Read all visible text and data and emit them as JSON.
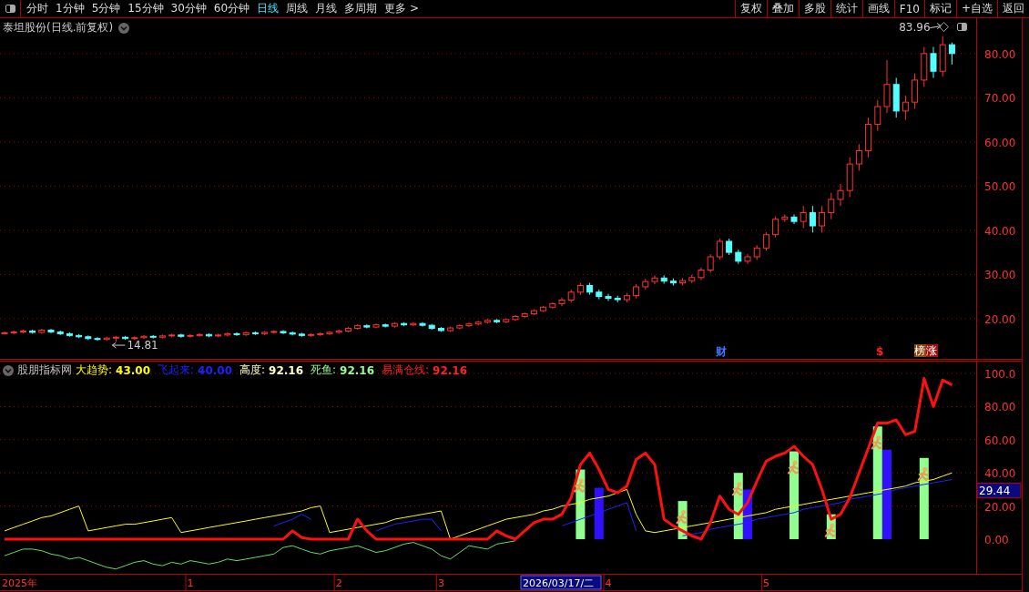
{
  "toolbar": {
    "periods": [
      {
        "label": "分时",
        "selected": false
      },
      {
        "label": "1分钟",
        "selected": false
      },
      {
        "label": "5分钟",
        "selected": false
      },
      {
        "label": "15分钟",
        "selected": false
      },
      {
        "label": "30分钟",
        "selected": false
      },
      {
        "label": "60分钟",
        "selected": false
      },
      {
        "label": "日线",
        "selected": true
      },
      {
        "label": "周线",
        "selected": false
      },
      {
        "label": "月线",
        "selected": false
      },
      {
        "label": "多周期",
        "selected": false
      },
      {
        "label": "更多 >",
        "selected": false
      }
    ],
    "buttons": [
      "复权",
      "叠加",
      "多股",
      "统计",
      "画线",
      "F10",
      "标记",
      "+自选",
      "返回"
    ]
  },
  "price_panel": {
    "title": "泰坦股份(日线.前复权)",
    "chart_data": {
      "type": "candlestick",
      "grid": true,
      "ylim": [
        10.7,
        88
      ],
      "yticks": [
        {
          "value": 20,
          "label": "20.00"
        },
        {
          "value": 30,
          "label": "30.00"
        },
        {
          "value": 40,
          "label": "40.00"
        },
        {
          "value": 50,
          "label": "50.00"
        },
        {
          "value": 60,
          "label": "60.00"
        },
        {
          "value": 70,
          "label": "70.00"
        },
        {
          "value": 80,
          "label": "80.00"
        }
      ],
      "ohlc": [
        [
          16.7,
          17.1,
          16.4,
          16.8
        ],
        [
          16.8,
          17.3,
          16.5,
          17
        ],
        [
          17,
          17.5,
          16.7,
          17.2
        ],
        [
          17.2,
          17.5,
          16.6,
          16.9
        ],
        [
          16.9,
          17.7,
          16.6,
          17.4
        ],
        [
          17.4,
          17.7,
          16.7,
          17
        ],
        [
          17,
          17.3,
          16.3,
          16.6
        ],
        [
          16.6,
          16.9,
          15.9,
          16.2
        ],
        [
          16.2,
          16.5,
          15.6,
          15.9
        ],
        [
          15.9,
          16.2,
          15.2,
          15.5
        ],
        [
          15.5,
          15.8,
          15,
          15.3
        ],
        [
          15.3,
          15.9,
          15,
          15.6
        ],
        [
          15.6,
          16.1,
          14.81,
          15.8
        ],
        [
          15.8,
          16.1,
          15.2,
          15.5
        ],
        [
          15.5,
          16,
          15.2,
          15.7
        ],
        [
          15.7,
          16.3,
          15.4,
          16
        ],
        [
          16,
          16.3,
          15.5,
          15.8
        ],
        [
          15.8,
          16.4,
          15.5,
          16.1
        ],
        [
          16.1,
          16.6,
          15.8,
          16.3
        ],
        [
          16.3,
          16.6,
          15.7,
          16
        ],
        [
          16,
          16.5,
          15.7,
          16.2
        ],
        [
          16.2,
          16.7,
          15.9,
          16.4
        ],
        [
          16.4,
          16.7,
          15.8,
          16.1
        ],
        [
          16.1,
          16.6,
          15.8,
          16.3
        ],
        [
          16.3,
          16.9,
          16,
          16.6
        ],
        [
          16.6,
          16.9,
          16.1,
          16.4
        ],
        [
          16.4,
          17.1,
          16.1,
          16.8
        ],
        [
          16.8,
          17.1,
          16.3,
          16.6
        ],
        [
          16.6,
          17.2,
          16.3,
          16.9
        ],
        [
          16.9,
          17.4,
          16.6,
          17.1
        ],
        [
          17.1,
          17.4,
          16.5,
          16.8
        ],
        [
          16.8,
          17.1,
          16.2,
          16.5
        ],
        [
          16.5,
          16.8,
          15.9,
          16.2
        ],
        [
          16.2,
          16.7,
          15.9,
          16.4
        ],
        [
          16.4,
          16.9,
          16.1,
          16.6
        ],
        [
          16.6,
          17.2,
          16.3,
          16.9
        ],
        [
          16.9,
          17.5,
          16.6,
          17.2
        ],
        [
          17.2,
          18.1,
          16.9,
          17.8
        ],
        [
          17.8,
          18.7,
          17.5,
          18.4
        ],
        [
          18.4,
          18.7,
          17.8,
          18.1
        ],
        [
          18.1,
          18.9,
          17.8,
          18.6
        ],
        [
          18.6,
          18.9,
          18,
          18.3
        ],
        [
          18.3,
          19.2,
          18,
          18.9
        ],
        [
          18.9,
          19.2,
          18.3,
          18.6
        ],
        [
          18.6,
          19.2,
          18.3,
          18.9
        ],
        [
          18.9,
          19.2,
          18.2,
          18.5
        ],
        [
          18.5,
          18.8,
          17.5,
          17.8
        ],
        [
          17.8,
          18.1,
          17,
          17.3
        ],
        [
          17.3,
          18.2,
          17,
          17.9
        ],
        [
          17.9,
          18.7,
          17.6,
          18.4
        ],
        [
          18.4,
          19.1,
          18.1,
          18.8
        ],
        [
          18.8,
          19.5,
          18.5,
          19.2
        ],
        [
          19.2,
          19.9,
          18.9,
          19.6
        ],
        [
          19.6,
          19.9,
          19,
          19.3
        ],
        [
          19.3,
          20.1,
          19,
          19.8
        ],
        [
          19.8,
          20.8,
          19.5,
          20.5
        ],
        [
          20.5,
          21.4,
          20.2,
          21.1
        ],
        [
          21.1,
          22.1,
          20.8,
          21.8
        ],
        [
          21.8,
          22.9,
          21.5,
          22.6
        ],
        [
          22.6,
          23.7,
          22.3,
          23.4
        ],
        [
          23.4,
          24.8,
          22.8,
          24.2
        ],
        [
          24.2,
          26.6,
          23.6,
          26
        ],
        [
          26,
          28.1,
          25.4,
          27.5
        ],
        [
          27.5,
          28.1,
          25.4,
          26
        ],
        [
          26,
          26.6,
          24.4,
          25
        ],
        [
          25,
          25.6,
          24,
          24.6
        ],
        [
          24.6,
          25.2,
          23.7,
          24.3
        ],
        [
          24.3,
          25.8,
          23.7,
          25.2
        ],
        [
          25.2,
          27.8,
          24.6,
          27.2
        ],
        [
          27.2,
          29,
          26.6,
          28.4
        ],
        [
          28.4,
          29.8,
          27.8,
          29.2
        ],
        [
          29.2,
          29.8,
          27.9,
          28.5
        ],
        [
          28.5,
          29.1,
          27.5,
          28.1
        ],
        [
          28.1,
          29.2,
          27.5,
          28.6
        ],
        [
          28.6,
          29.9,
          28,
          29.3
        ],
        [
          29.3,
          31.6,
          28.7,
          31
        ],
        [
          31,
          34.6,
          30.4,
          34
        ],
        [
          34,
          38.1,
          33.4,
          37.5
        ],
        [
          37.5,
          38.1,
          34.4,
          35
        ],
        [
          35,
          35.6,
          32.4,
          33
        ],
        [
          33,
          34.6,
          32.4,
          34
        ],
        [
          34,
          36.6,
          33.3,
          36
        ],
        [
          36,
          39.6,
          35.4,
          39
        ],
        [
          39,
          43.1,
          38.4,
          42.5
        ],
        [
          42.5,
          43.6,
          41.9,
          43
        ],
        [
          43,
          43.6,
          41.4,
          42
        ],
        [
          42,
          45.5,
          40.5,
          44
        ],
        [
          44,
          45.5,
          39.5,
          41
        ],
        [
          41,
          45.5,
          39.5,
          44
        ],
        [
          44,
          48.5,
          42.5,
          47
        ],
        [
          47,
          50.5,
          45.5,
          49
        ],
        [
          49,
          56.5,
          47.5,
          55
        ],
        [
          55,
          59.5,
          53.5,
          58
        ],
        [
          58,
          65.5,
          56.5,
          64
        ],
        [
          64,
          69.5,
          62.5,
          68
        ],
        [
          68,
          78.5,
          66.5,
          73
        ],
        [
          73,
          74.5,
          65.5,
          67
        ],
        [
          67,
          70.5,
          65,
          69
        ],
        [
          69,
          75.5,
          67.5,
          74
        ],
        [
          74,
          81.5,
          72.5,
          80
        ],
        [
          80,
          81.5,
          74.5,
          76
        ],
        [
          76,
          83.96,
          74.8,
          82
        ],
        [
          82,
          82.5,
          77.5,
          80
        ]
      ],
      "annotations": [
        "83.96",
        "14.81"
      ]
    },
    "event_marks": [
      {
        "text": "财",
        "color": "#3c78ff",
        "badge": false
      },
      {
        "text": "$",
        "color": "#ff2020",
        "badge": false
      },
      {
        "text": "榜",
        "color": "#8a4a10",
        "badge": true
      },
      {
        "text": "涨",
        "color": "#a01010",
        "badge": true
      }
    ]
  },
  "indicator_panel": {
    "legend": [
      {
        "label": "股朋指标网"
      },
      {
        "label": "大趋势:",
        "value": "43.00",
        "color": "#ffff00"
      },
      {
        "label": "飞起来:",
        "value": "40.00",
        "color": "#2020ff"
      },
      {
        "label": "高度:",
        "value": "92.16",
        "color": "#ffffc0"
      },
      {
        "label": "死鱼:",
        "value": "92.16",
        "color": "#90ff90"
      },
      {
        "label": "易满仓线:",
        "value": "92.16",
        "color": "#ff2020"
      }
    ],
    "axis_start_label": "2025年",
    "chart_data": {
      "type": "line",
      "grid": true,
      "ylim": [
        -20.9,
        107.7
      ],
      "yticks": [
        {
          "value": 0,
          "label": "0.00"
        },
        {
          "value": 20,
          "label": "20.00"
        },
        {
          "value": 40,
          "label": "40.00"
        },
        {
          "value": 60,
          "label": "60.00"
        },
        {
          "value": 80,
          "label": "80.00"
        },
        {
          "value": 100,
          "label": "100.0"
        }
      ],
      "categories": [
        null,
        null,
        null,
        null,
        null,
        null,
        null,
        null,
        null,
        null,
        null,
        null,
        null,
        null,
        null,
        null,
        null,
        null,
        null,
        null,
        "1",
        null,
        null,
        null,
        null,
        null,
        null,
        null,
        null,
        null,
        null,
        null,
        null,
        null,
        null,
        null,
        "2",
        null,
        null,
        null,
        null,
        null,
        null,
        null,
        null,
        null,
        null,
        "3",
        null,
        null,
        null,
        null,
        null,
        null,
        null,
        null,
        null,
        null,
        null,
        null,
        null,
        null,
        null,
        null,
        null,
        "4",
        null,
        null,
        null,
        null,
        null,
        null,
        null,
        null,
        null,
        null,
        null,
        null,
        null,
        null,
        null,
        null,
        "5",
        null,
        null,
        null,
        null,
        null,
        null,
        null,
        null,
        null,
        null,
        null,
        null,
        null,
        null,
        null,
        null,
        null,
        null,
        null,
        null
      ],
      "series": [
        {
          "type": "bar",
          "color": "#90ff90",
          "values": [
            null,
            null,
            null,
            null,
            null,
            null,
            null,
            null,
            null,
            null,
            null,
            null,
            null,
            null,
            null,
            null,
            null,
            null,
            null,
            null,
            null,
            null,
            null,
            null,
            null,
            null,
            null,
            null,
            null,
            null,
            null,
            null,
            null,
            null,
            null,
            null,
            null,
            null,
            null,
            null,
            null,
            null,
            null,
            null,
            null,
            null,
            null,
            null,
            null,
            null,
            null,
            null,
            null,
            null,
            null,
            null,
            null,
            null,
            null,
            null,
            null,
            null,
            42,
            null,
            null,
            null,
            null,
            null,
            null,
            null,
            null,
            null,
            null,
            23,
            null,
            null,
            null,
            null,
            null,
            40,
            null,
            null,
            null,
            null,
            null,
            53,
            null,
            null,
            null,
            15,
            null,
            null,
            null,
            null,
            68,
            null,
            null,
            null,
            null,
            49,
            null,
            null,
            null
          ]
        },
        {
          "type": "bar",
          "color": "#3010ff",
          "values": [
            null,
            null,
            null,
            null,
            null,
            null,
            null,
            null,
            null,
            null,
            null,
            null,
            null,
            null,
            null,
            null,
            null,
            null,
            null,
            null,
            null,
            null,
            null,
            null,
            null,
            null,
            null,
            null,
            null,
            null,
            null,
            null,
            null,
            null,
            null,
            null,
            null,
            null,
            null,
            null,
            null,
            null,
            null,
            null,
            null,
            null,
            null,
            null,
            null,
            null,
            null,
            null,
            null,
            null,
            null,
            null,
            null,
            null,
            null,
            null,
            null,
            null,
            null,
            null,
            31,
            null,
            null,
            null,
            null,
            null,
            null,
            null,
            null,
            null,
            null,
            null,
            null,
            null,
            null,
            null,
            30,
            null,
            null,
            null,
            null,
            null,
            null,
            null,
            null,
            null,
            null,
            null,
            null,
            null,
            null,
            54,
            null,
            null,
            null,
            null,
            null,
            null,
            null
          ]
        },
        {
          "type": "line",
          "color": "#ffff00",
          "values": [
            5,
            7,
            9,
            11,
            13,
            14,
            16,
            18,
            20,
            5,
            6,
            7,
            8,
            9,
            9,
            10,
            11,
            12,
            13,
            4,
            5,
            6,
            7,
            8,
            9,
            10,
            11,
            12,
            13,
            14,
            15,
            16,
            17,
            19,
            20,
            4,
            5,
            6,
            7,
            8,
            9,
            10,
            12,
            13,
            14,
            15,
            16,
            17,
            0,
            2,
            4,
            6,
            8,
            10,
            12,
            13,
            14,
            15,
            17,
            18,
            20,
            21,
            22,
            24,
            25,
            26,
            28,
            30,
            15,
            5,
            4,
            5,
            6,
            7,
            8,
            9,
            10,
            11,
            12,
            13,
            14,
            15,
            16,
            18,
            19,
            20,
            21,
            22,
            23,
            24,
            25,
            26,
            27,
            28,
            29,
            30,
            31,
            32,
            34,
            35,
            36,
            38,
            40
          ]
        },
        {
          "type": "line",
          "color": "#2020ff",
          "values": [
            null,
            null,
            null,
            null,
            null,
            null,
            null,
            null,
            null,
            null,
            null,
            null,
            null,
            null,
            null,
            null,
            null,
            null,
            null,
            null,
            null,
            null,
            null,
            null,
            null,
            null,
            null,
            null,
            null,
            8,
            10,
            12,
            15,
            12,
            null,
            null,
            null,
            null,
            null,
            null,
            5,
            7,
            9,
            10,
            11,
            12,
            12,
            5,
            null,
            null,
            null,
            null,
            null,
            null,
            null,
            null,
            null,
            null,
            null,
            null,
            8,
            10,
            12,
            14,
            16,
            18,
            20,
            22,
            5,
            null,
            null,
            null,
            null,
            2,
            3,
            4,
            6,
            7,
            8,
            9,
            10,
            12,
            13,
            14,
            15,
            16,
            18,
            19,
            20,
            21,
            22,
            24,
            25,
            26,
            27,
            28,
            30,
            31,
            32,
            33,
            34,
            35,
            36
          ]
        },
        {
          "type": "line",
          "color": "#60e060",
          "values": [
            -10,
            -8,
            -6,
            -6,
            -7,
            -9,
            -10,
            -12,
            -11,
            -13,
            -15,
            -17,
            -18,
            -16,
            -14,
            -13,
            -15,
            -16,
            -14,
            -15,
            -13,
            -14,
            -15,
            -14,
            -12,
            -13,
            -12,
            -11,
            -10,
            -9,
            -5,
            -4,
            -6,
            -8,
            -9,
            -7,
            -6,
            -5,
            -4,
            -6,
            -8,
            -7,
            -5,
            -3,
            -2,
            -4,
            -6,
            -10,
            -12,
            -8,
            -4,
            -5,
            -6,
            -3,
            -2,
            -1,
            null,
            null,
            null,
            null,
            null,
            null,
            null,
            null,
            null,
            null,
            null,
            null,
            null,
            null,
            null,
            null,
            null,
            null,
            null,
            null,
            null,
            null,
            null,
            null,
            null,
            null,
            null,
            null,
            null,
            null,
            null,
            null,
            null,
            null,
            null,
            null,
            null,
            null,
            null,
            null,
            null,
            null,
            null,
            null,
            null,
            null,
            null
          ]
        },
        {
          "type": "line",
          "color": "#ff1010",
          "values": [
            0,
            0,
            0,
            0,
            0,
            0,
            0,
            0,
            0,
            0,
            0,
            0,
            0,
            0,
            0,
            0,
            0,
            0,
            0,
            0,
            0,
            0,
            0,
            0,
            0,
            0,
            0,
            0,
            0,
            0,
            0,
            5,
            1,
            0,
            0,
            0,
            0,
            0,
            12,
            5,
            0,
            0,
            0,
            0,
            0,
            0,
            0,
            0,
            0,
            0,
            0,
            0,
            0,
            5,
            2,
            0,
            5,
            10,
            12,
            12,
            15,
            25,
            45,
            52,
            42,
            30,
            28,
            32,
            48,
            52,
            45,
            12,
            8,
            5,
            2,
            0,
            10,
            26,
            18,
            15,
            22,
            35,
            47,
            50,
            52,
            56,
            50,
            45,
            30,
            12,
            15,
            25,
            40,
            55,
            70,
            70,
            72,
            63,
            65,
            97,
            80,
            96,
            93
          ]
        }
      ]
    },
    "crosshair": {
      "value": "29.44",
      "date": "2026/03/17/二"
    }
  }
}
